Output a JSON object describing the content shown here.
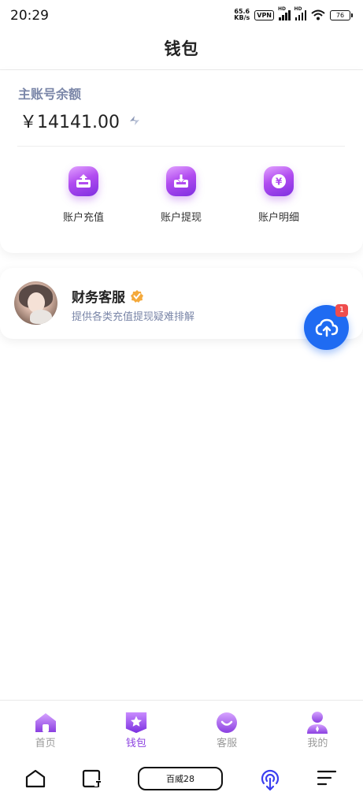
{
  "status_bar": {
    "time": "20:29",
    "net_speed_value": "65.6",
    "net_speed_unit": "KB/s",
    "vpn": "VPN",
    "hd_1": "HD",
    "hd_2": "HD",
    "battery": "76"
  },
  "header": {
    "title": "钱包"
  },
  "wallet": {
    "balance_label": "主账号余额",
    "balance": "￥14141.00",
    "actions": [
      {
        "label": "账户充值",
        "icon": "deposit-icon"
      },
      {
        "label": "账户提现",
        "icon": "withdraw-icon"
      },
      {
        "label": "账户明细",
        "icon": "yuan-details-icon"
      }
    ]
  },
  "support": {
    "name": "财务客服",
    "description": "提供各类充值提现疑难排解"
  },
  "fab": {
    "badge": "1",
    "icon": "cloud-upload-icon"
  },
  "tabs": [
    {
      "label": "首页",
      "icon": "home-icon",
      "active": false
    },
    {
      "label": "钱包",
      "icon": "wallet-star-icon",
      "active": true
    },
    {
      "label": "客服",
      "icon": "smile-icon",
      "active": false
    },
    {
      "label": "我的",
      "icon": "person-icon",
      "active": false
    }
  ],
  "system_nav": {
    "pill_text": "百威28"
  },
  "colors": {
    "accent": "#8a3fe0",
    "fab": "#1f6bf2",
    "muted_text": "#7a86a8",
    "badge": "#ef4d4d"
  }
}
